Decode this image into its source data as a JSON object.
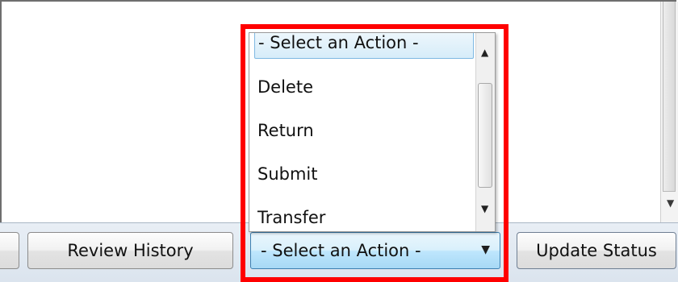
{
  "dropdown": {
    "selected_label": "- Select an Action -",
    "options": [
      "Delete",
      "Return",
      "Submit",
      "Transfer"
    ]
  },
  "toolbar": {
    "review_history_label": "Review History",
    "action_combo_value": "- Select an Action -",
    "update_status_label": "Update Status"
  },
  "icons": {
    "scroll_up": "chevron-up-icon",
    "scroll_down": "chevron-down-icon",
    "combo_arrow": "chevron-down-icon"
  },
  "colors": {
    "highlight": "#ff0000",
    "combo_border": "#3c7fb1"
  }
}
